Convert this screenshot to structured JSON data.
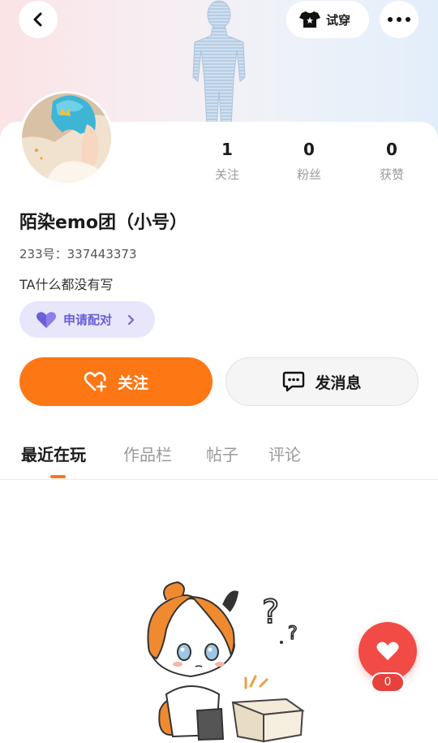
{
  "header": {
    "try_on_label": "试穿"
  },
  "profile": {
    "name": "陌染emo团（小号）",
    "uid": "233号：337443373",
    "bio": "TA什么都没有写",
    "pair_label": "申请配对"
  },
  "stats": [
    {
      "value": "1",
      "label": "关注"
    },
    {
      "value": "0",
      "label": "粉丝"
    },
    {
      "value": "0",
      "label": "获赞"
    }
  ],
  "actions": {
    "follow_label": "关注",
    "message_label": "发消息"
  },
  "tabs": [
    {
      "label": "最近在玩",
      "active": true
    },
    {
      "label": "作品栏",
      "active": false
    },
    {
      "label": "帖子",
      "active": false
    },
    {
      "label": "评论",
      "active": false
    }
  ],
  "like": {
    "count": "0"
  },
  "colors": {
    "accent": "#fd7715",
    "pair": "#6a5ed9",
    "like": "#f24a45"
  },
  "icons": [
    "back-arrow-icon",
    "shirt-icon",
    "more-icon",
    "heart-icon",
    "chevron-right-icon",
    "heart-plus-icon",
    "chat-bubble-icon"
  ]
}
